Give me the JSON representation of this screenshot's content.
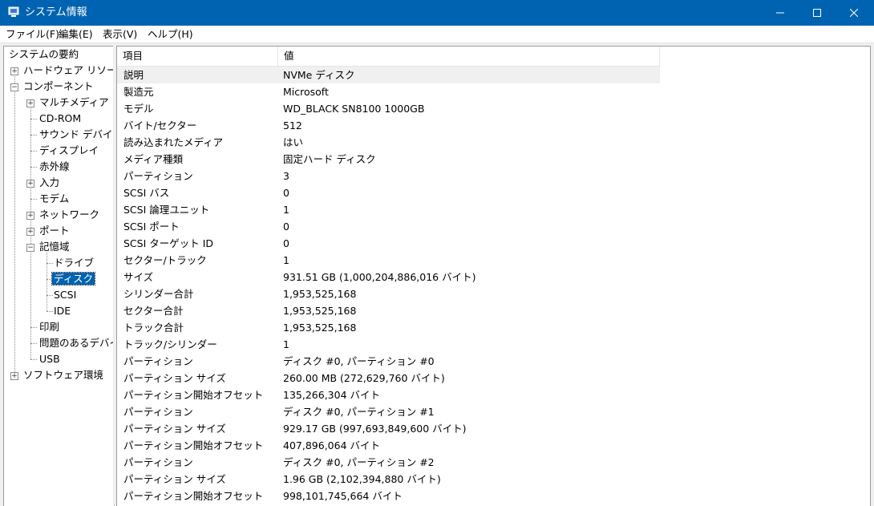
{
  "window": {
    "title": "システム情報"
  },
  "menu": [
    "ファイル(F)",
    "編集(E)",
    "表示(V)",
    "ヘルプ(H)"
  ],
  "tree": [
    {
      "label": "システムの要約",
      "level": 0,
      "expander": ""
    },
    {
      "label": "ハードウェア リソース",
      "level": 1,
      "expander": "+"
    },
    {
      "label": "コンポーネント",
      "level": 1,
      "expander": "-"
    },
    {
      "label": "マルチメディア",
      "level": 2,
      "expander": "+"
    },
    {
      "label": "CD-ROM",
      "level": 2,
      "expander": ""
    },
    {
      "label": "サウンド デバイス",
      "level": 2,
      "expander": ""
    },
    {
      "label": "ディスプレイ",
      "level": 2,
      "expander": ""
    },
    {
      "label": "赤外線",
      "level": 2,
      "expander": ""
    },
    {
      "label": "入力",
      "level": 2,
      "expander": "+"
    },
    {
      "label": "モデム",
      "level": 2,
      "expander": ""
    },
    {
      "label": "ネットワーク",
      "level": 2,
      "expander": "+"
    },
    {
      "label": "ポート",
      "level": 2,
      "expander": "+"
    },
    {
      "label": "記憶域",
      "level": 2,
      "expander": "-"
    },
    {
      "label": "ドライブ",
      "level": 3,
      "expander": ""
    },
    {
      "label": "ディスク",
      "level": 3,
      "expander": "",
      "selected": true
    },
    {
      "label": "SCSI",
      "level": 3,
      "expander": ""
    },
    {
      "label": "IDE",
      "level": 3,
      "expander": ""
    },
    {
      "label": "印刷",
      "level": 2,
      "expander": ""
    },
    {
      "label": "問題のあるデバイス",
      "level": 2,
      "expander": ""
    },
    {
      "label": "USB",
      "level": 2,
      "expander": ""
    },
    {
      "label": "ソフトウェア環境",
      "level": 1,
      "expander": "+"
    }
  ],
  "table": {
    "columns": [
      "項目",
      "値"
    ],
    "rows": [
      [
        "説明",
        "NVMe ディスク"
      ],
      [
        "製造元",
        "Microsoft"
      ],
      [
        "モデル",
        "WD_BLACK SN8100 1000GB"
      ],
      [
        "バイト/セクター",
        "512"
      ],
      [
        "読み込まれたメディア",
        "はい"
      ],
      [
        "メディア種類",
        "固定ハード ディスク"
      ],
      [
        "パーティション",
        "3"
      ],
      [
        "SCSI バス",
        "0"
      ],
      [
        "SCSI 論理ユニット",
        "1"
      ],
      [
        "SCSI ポート",
        "0"
      ],
      [
        "SCSI ターゲット ID",
        "0"
      ],
      [
        "セクター/トラック",
        "1"
      ],
      [
        "サイズ",
        "931.51 GB (1,000,204,886,016 バイト)"
      ],
      [
        "シリンダー合計",
        "1,953,525,168"
      ],
      [
        "セクター合計",
        "1,953,525,168"
      ],
      [
        "トラック合計",
        "1,953,525,168"
      ],
      [
        "トラック/シリンダー",
        "1"
      ],
      [
        "パーティション",
        "ディスク #0, パーティション #0"
      ],
      [
        "パーティション サイズ",
        "260.00 MB (272,629,760 バイト)"
      ],
      [
        "パーティション開始オフセット",
        "135,266,304 バイト"
      ],
      [
        "パーティション",
        "ディスク #0, パーティション #1"
      ],
      [
        "パーティション サイズ",
        "929.17 GB (997,693,849,600 バイト)"
      ],
      [
        "パーティション開始オフセット",
        "407,896,064 バイト"
      ],
      [
        "パーティション",
        "ディスク #0, パーティション #2"
      ],
      [
        "パーティション サイズ",
        "1.96 GB (2,102,394,880 バイト)"
      ],
      [
        "パーティション開始オフセット",
        "998,101,745,664 バイト"
      ]
    ]
  },
  "colors": {
    "titlebar": "#0063b1",
    "selection": "#0063b1"
  }
}
